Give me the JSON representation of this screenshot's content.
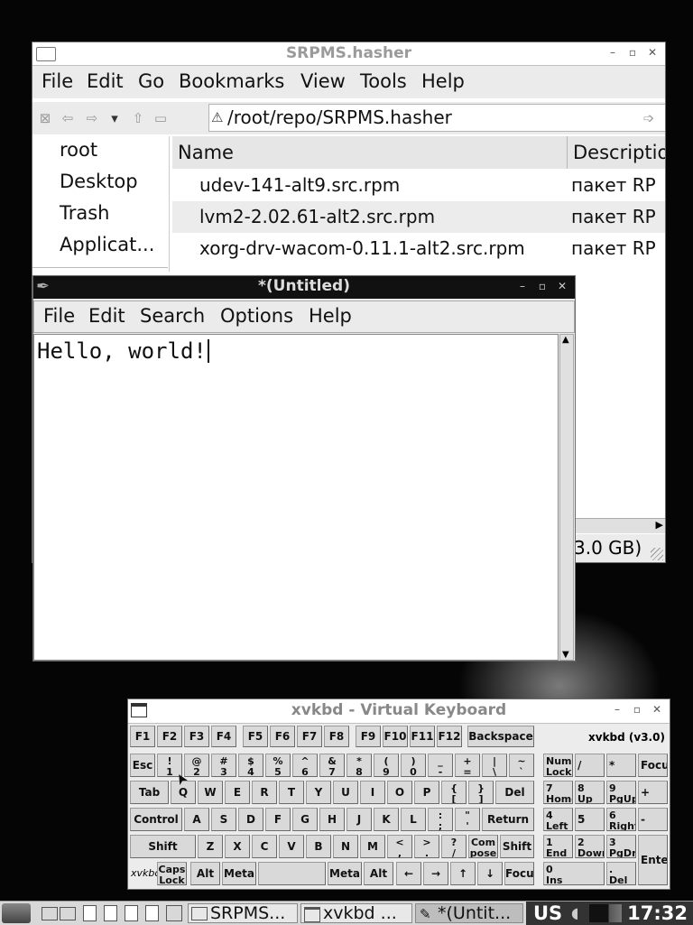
{
  "file_manager": {
    "title": "SRPMS.hasher",
    "menu": [
      "File",
      "Edit",
      "Go",
      "Bookmarks",
      "View",
      "Tools",
      "Help"
    ],
    "location": "/root/repo/SRPMS.hasher",
    "sidebar": [
      "root",
      "Desktop",
      "Trash",
      "Applicat..."
    ],
    "columns": [
      "Name",
      "Descriptio"
    ],
    "rows": [
      {
        "name": "udev-141-alt9.src.rpm",
        "desc": "пакет RP"
      },
      {
        "name": "lvm2-2.02.61-alt2.src.rpm",
        "desc": "пакет RP"
      },
      {
        "name": "xorg-drv-wacom-0.11.1-alt2.src.rpm",
        "desc": "пакет RP"
      }
    ],
    "status": "3.0 GB)"
  },
  "editor": {
    "title": "*(Untitled)",
    "menu": [
      "File",
      "Edit",
      "Search",
      "Options",
      "Help"
    ],
    "content": "Hello, world!"
  },
  "keyboard": {
    "title": "xvkbd - Virtual Keyboard",
    "version": "xvkbd (v3.0)",
    "brand": "xvkbd",
    "fkeys": [
      "F1",
      "F2",
      "F3",
      "F4",
      "F5",
      "F6",
      "F7",
      "F8",
      "F9",
      "F10",
      "F11",
      "F12"
    ],
    "backspace": "Backspace",
    "esc": "Esc",
    "num_row": [
      {
        "top": "!",
        "bot": "1"
      },
      {
        "top": "@",
        "bot": "2"
      },
      {
        "top": "#",
        "bot": "3"
      },
      {
        "top": "$",
        "bot": "4"
      },
      {
        "top": "%",
        "bot": "5"
      },
      {
        "top": "^",
        "bot": "6"
      },
      {
        "top": "&",
        "bot": "7"
      },
      {
        "top": "*",
        "bot": "8"
      },
      {
        "top": "(",
        "bot": "9"
      },
      {
        "top": ")",
        "bot": "0"
      },
      {
        "top": "_",
        "bot": "-"
      },
      {
        "top": "+",
        "bot": "="
      },
      {
        "top": "|",
        "bot": "\\"
      },
      {
        "top": "~",
        "bot": "`"
      }
    ],
    "tab": "Tab",
    "row_q": [
      "Q",
      "W",
      "E",
      "R",
      "T",
      "Y",
      "U",
      "I",
      "O",
      "P"
    ],
    "bracket_open": {
      "top": "{",
      "bot": "["
    },
    "bracket_close": {
      "top": "}",
      "bot": "]"
    },
    "del": "Del",
    "control": "Control",
    "row_a": [
      "A",
      "S",
      "D",
      "F",
      "G",
      "H",
      "J",
      "K",
      "L"
    ],
    "semicolon": {
      "top": ":",
      "bot": ";"
    },
    "quote": {
      "top": "\"",
      "bot": "'"
    },
    "return": "Return",
    "shift": "Shift",
    "row_z": [
      "Z",
      "X",
      "C",
      "V",
      "B",
      "N",
      "M"
    ],
    "comma": {
      "top": "<",
      "bot": ","
    },
    "period": {
      "top": ">",
      "bot": "."
    },
    "slash": {
      "top": "?",
      "bot": "/"
    },
    "compose": {
      "top": "Com",
      "bot": "pose"
    },
    "capslock": {
      "top": "Caps",
      "bot": "Lock"
    },
    "alt": "Alt",
    "meta": "Meta",
    "left": "←",
    "right": "→",
    "up": "↑",
    "down": "↓",
    "focus": "Focus",
    "numpad": {
      "numlock": {
        "top": "Num",
        "bot": "Lock"
      },
      "div": "/",
      "mul": "*",
      "focus": "Focus",
      "k7": {
        "top": "7",
        "bot": "Home"
      },
      "k8": {
        "top": "8",
        "bot": "Up"
      },
      "k9": {
        "top": "9",
        "bot": "PgUp"
      },
      "plus": "+",
      "k4": {
        "top": "4",
        "bot": "Left"
      },
      "k5": "5",
      "k6": {
        "top": "6",
        "bot": "Right"
      },
      "minus": "-",
      "k1": {
        "top": "1",
        "bot": "End"
      },
      "k2": {
        "top": "2",
        "bot": "Down"
      },
      "k3": {
        "top": "3",
        "bot": "PgDn"
      },
      "enter": "Enter",
      "k0": {
        "top": "0",
        "bot": "Ins"
      },
      "dot": {
        "top": ".",
        "bot": "Del"
      }
    }
  },
  "taskbar": {
    "tasks": [
      "SRPMS...",
      "xvkbd ...",
      "*(Untit..."
    ],
    "layout": "US",
    "clock": "17:32"
  }
}
